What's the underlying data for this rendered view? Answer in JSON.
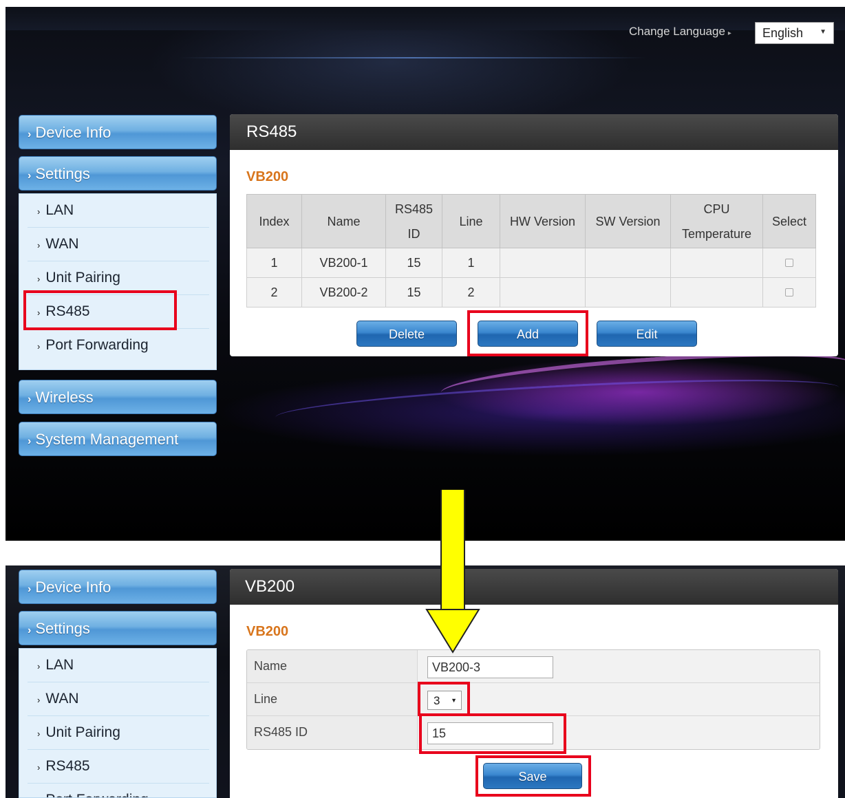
{
  "language": {
    "label": "Change Language",
    "selected": "English"
  },
  "sidebar_top": {
    "device_info": "Device Info",
    "settings": "Settings",
    "sub_items": [
      "LAN",
      "WAN",
      "Unit Pairing",
      "RS485",
      "Port Forwarding"
    ],
    "wireless": "Wireless",
    "system_management": "System Management"
  },
  "sidebar_bottom": {
    "device_info": "Device Info",
    "settings": "Settings",
    "sub_items": [
      "LAN",
      "WAN",
      "Unit Pairing",
      "RS485",
      "Port Forwarding"
    ]
  },
  "rs485_panel": {
    "header": "RS485",
    "section": "VB200",
    "columns": {
      "index": "Index",
      "name": "Name",
      "id_line1": "RS485",
      "id_line2": "ID",
      "line": "Line",
      "hw": "HW Version",
      "sw": "SW Version",
      "cpu_line1": "CPU",
      "cpu_line2": "Temperature",
      "select": "Select"
    },
    "rows": [
      {
        "index": "1",
        "name": "VB200-1",
        "id": "15",
        "line": "1",
        "hw": "",
        "sw": "",
        "cpu": ""
      },
      {
        "index": "2",
        "name": "VB200-2",
        "id": "15",
        "line": "2",
        "hw": "",
        "sw": "",
        "cpu": ""
      }
    ],
    "buttons": {
      "delete": "Delete",
      "add": "Add",
      "edit": "Edit"
    }
  },
  "vb200_panel": {
    "header": "VB200",
    "section": "VB200",
    "fields": {
      "name_label": "Name",
      "name_value": "VB200-3",
      "line_label": "Line",
      "line_value": "3",
      "id_label": "RS485 ID",
      "id_value": "15"
    },
    "save": "Save"
  },
  "colors": {
    "accent_orange": "#d8751c",
    "highlight_red": "#e8001c",
    "arrow_yellow": "#ffff00",
    "button_blue": "#3a87cf"
  }
}
